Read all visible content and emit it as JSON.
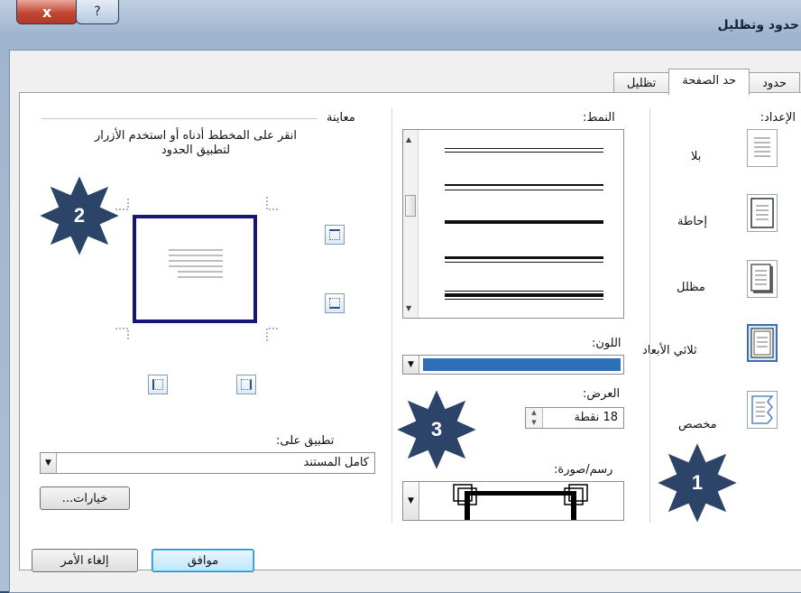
{
  "window": {
    "title": "حدود وتظليل",
    "close_glyph": "x",
    "help_glyph": "?"
  },
  "tabs": [
    "حدود",
    "حد الصفحة",
    "تظليل"
  ],
  "setting": {
    "heading": "الإعداد:",
    "items": [
      {
        "label": "بلا",
        "icon": "none-setting-icon"
      },
      {
        "label": "إحاطة",
        "icon": "box-setting-icon"
      },
      {
        "label": "مظلل",
        "icon": "shadow-setting-icon"
      },
      {
        "label": "ثلاثي الأبعاد",
        "icon": "3d-setting-icon",
        "selected": true
      },
      {
        "label": "مخصص",
        "icon": "custom-setting-icon"
      }
    ]
  },
  "style": {
    "heading": "النمط:"
  },
  "color": {
    "label": "اللون:",
    "value_color": "#2f6fb7"
  },
  "width": {
    "label": "العرض:",
    "value": "18 نقطة"
  },
  "art": {
    "label": "رسم/صورة:"
  },
  "preview": {
    "heading": "معاينة",
    "instructions": "انقر على المخطط أدناه أو استخدم الأزرار لتطبيق الحدود"
  },
  "apply_to": {
    "label": "تطبيق على:",
    "value": "كامل المستند"
  },
  "options_button": "خيارات...",
  "ok_button": "موافق",
  "cancel_button": "إلغاء الأمر",
  "callouts": [
    "1",
    "2",
    "3"
  ],
  "colors": {
    "accent": "#1f3a6a",
    "star": "#2c4468",
    "star_border": "#ffffff",
    "preview_border": "#15157a"
  }
}
